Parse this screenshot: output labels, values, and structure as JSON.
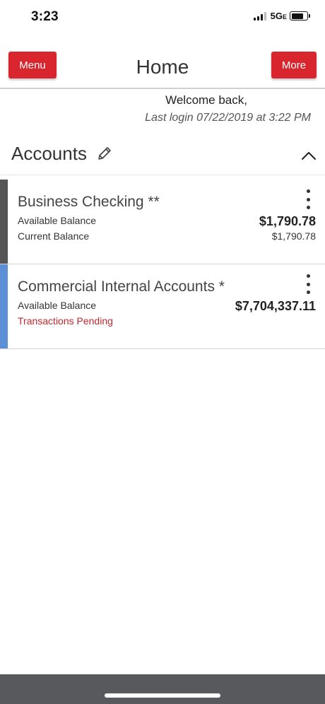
{
  "status_bar": {
    "time": "3:23",
    "network": "5G",
    "network_suffix": "E",
    "battery_level": 0.8,
    "icons": [
      "signal-icon",
      "battery-icon"
    ]
  },
  "header": {
    "menu_label": "Menu",
    "title": "Home",
    "more_label": "More",
    "button_color": "#d9252e"
  },
  "welcome": {
    "greeting": "Welcome back,",
    "last_login": "Last login 07/22/2019 at 3:22 PM"
  },
  "accounts_section": {
    "title": "Accounts",
    "edit_icon": "pencil-icon",
    "collapse_icon": "chevron-up-icon"
  },
  "accounts": [
    {
      "name": "Business Checking **",
      "label_1": "Available Balance",
      "amount_1": "$1,790.78",
      "label_2": "Current Balance",
      "amount_2": "$1,790.78",
      "stripe_color": "#555555",
      "menu_icon": "more-vertical-icon"
    },
    {
      "name": "Commercial Internal Accounts *",
      "label_1": "Available Balance",
      "amount_1": "$7,704,337.11",
      "label_2": "Transactions Pending",
      "stripe_color": "#5b8fd6",
      "pending_color": "#c0272d",
      "menu_icon": "more-vertical-icon"
    }
  ]
}
